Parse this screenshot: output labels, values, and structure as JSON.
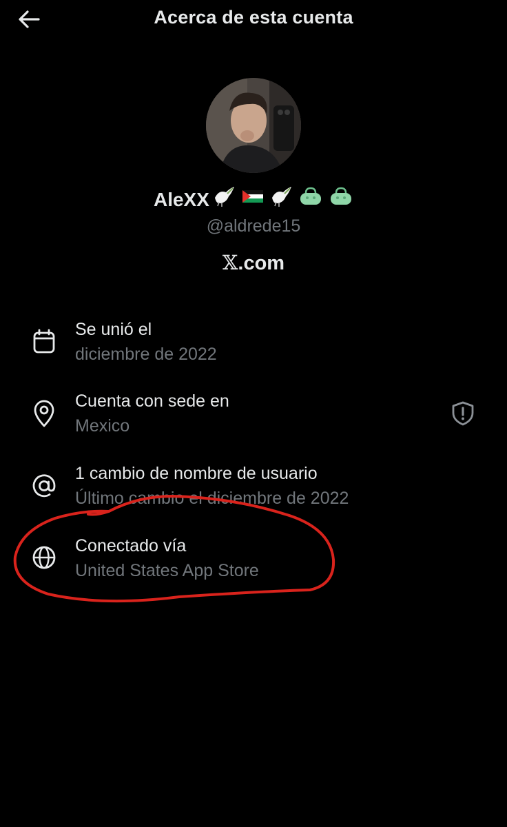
{
  "header": {
    "title": "Acerca de esta cuenta",
    "back_icon": "arrow-left-icon"
  },
  "profile": {
    "display_name": "AleXX",
    "name_emojis": [
      "dove-icon",
      "palestine-flag-icon",
      "dove-icon",
      "green-bag-icon",
      "green-bag-icon"
    ],
    "handle": "@aldrede15",
    "website_mark": "𝕏",
    "website_rest": ".com"
  },
  "info": {
    "joined": {
      "icon": "calendar-icon",
      "title": "Se unió el",
      "value": "diciembre de 2022"
    },
    "location": {
      "icon": "location-pin-icon",
      "title": "Cuenta con sede en",
      "value": "Mexico",
      "action_icon": "shield-alert-icon"
    },
    "username_changes": {
      "icon": "at-sign-icon",
      "title": "1 cambio de nombre de usuario",
      "value": "Último cambio el diciembre de 2022"
    },
    "connected": {
      "icon": "globe-icon",
      "title": "Conectado vía",
      "value": "United States App Store"
    }
  },
  "colors": {
    "background": "#000000",
    "primary_text": "#e7e9ea",
    "secondary_text": "#71767b",
    "annotation": "#d9231c"
  }
}
